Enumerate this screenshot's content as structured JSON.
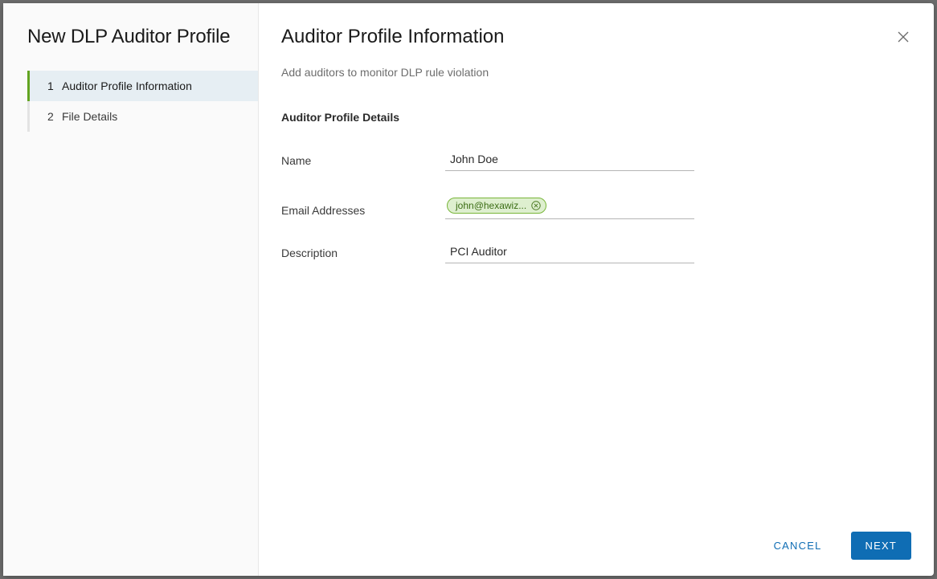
{
  "sidebar": {
    "title": "New DLP Auditor Profile",
    "steps": [
      {
        "num": "1",
        "label": "Auditor Profile Information",
        "active": true
      },
      {
        "num": "2",
        "label": "File Details",
        "active": false
      }
    ]
  },
  "main": {
    "title": "Auditor Profile Information",
    "subtitle": "Add auditors to monitor DLP rule violation",
    "section_heading": "Auditor Profile Details",
    "fields": {
      "name": {
        "label": "Name",
        "value": "John Doe"
      },
      "emails": {
        "label": "Email Addresses",
        "chips": [
          {
            "text": "john@hexawiz..."
          }
        ]
      },
      "description": {
        "label": "Description",
        "value": "PCI Auditor"
      }
    }
  },
  "footer": {
    "cancel": "CANCEL",
    "next": "NEXT"
  }
}
